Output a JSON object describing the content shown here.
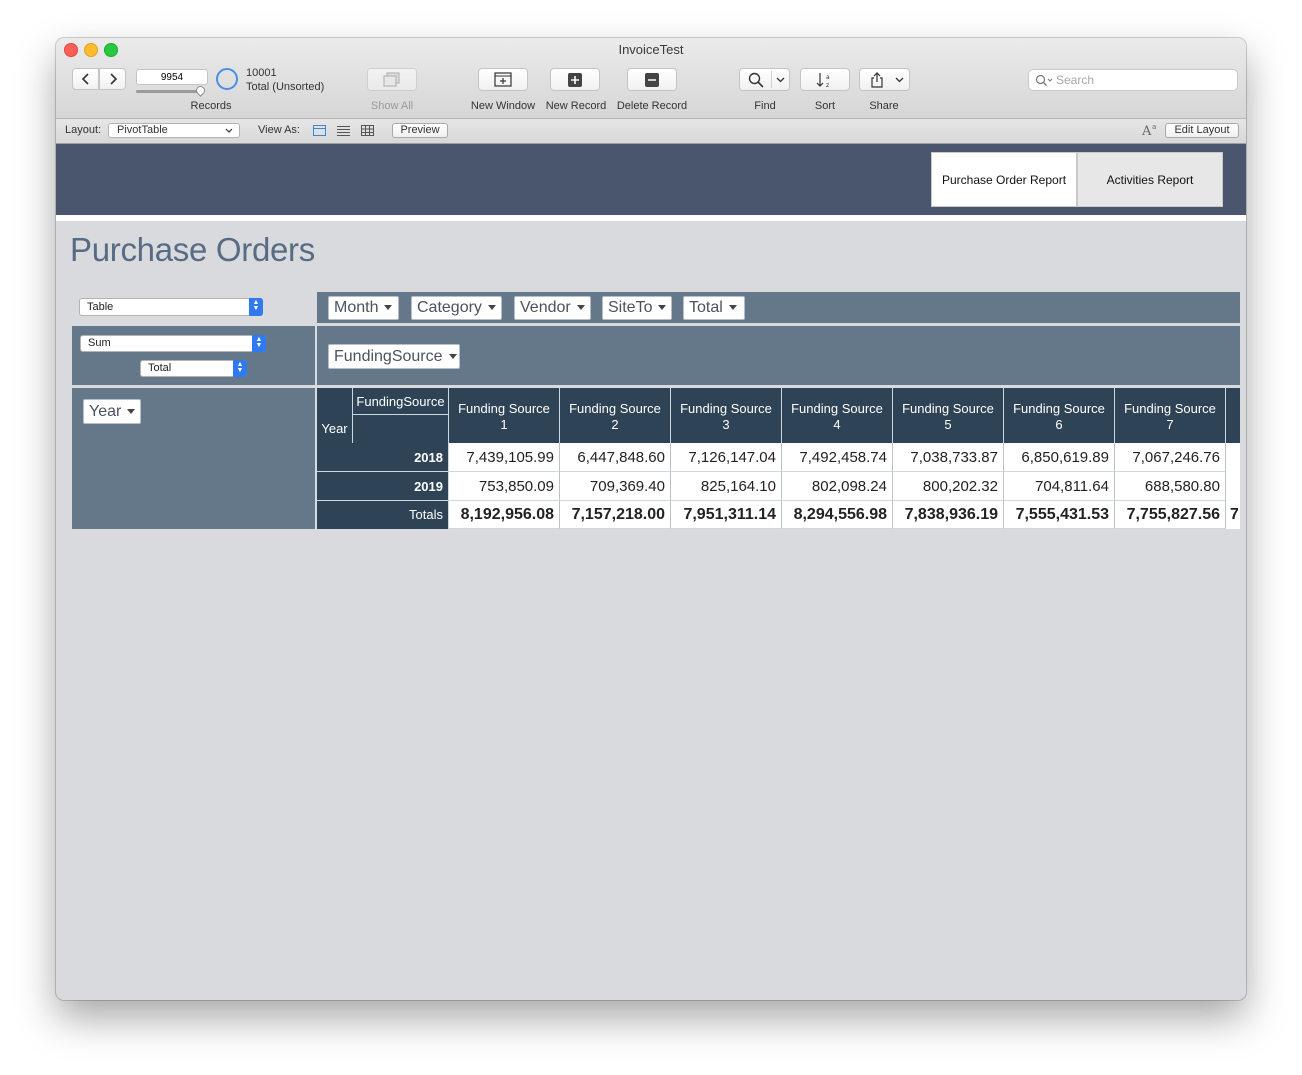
{
  "window": {
    "title": "InvoiceTest"
  },
  "toolbar": {
    "record_number": "9954",
    "records_label": "Records",
    "record_count": "10001",
    "record_status": "Total (Unsorted)",
    "show_all_label": "Show All",
    "new_window_label": "New Window",
    "new_record_label": "New Record",
    "delete_record_label": "Delete Record",
    "find_label": "Find",
    "sort_label": "Sort",
    "share_label": "Share",
    "search_placeholder": "Search"
  },
  "layout_bar": {
    "layout_label": "Layout:",
    "layout_value": "PivotTable",
    "view_as_label": "View As:",
    "preview_label": "Preview",
    "edit_layout_label": "Edit Layout"
  },
  "tabs": [
    {
      "label": "Purchase Order Report",
      "active": true
    },
    {
      "label": "Activities Report",
      "active": false
    }
  ],
  "page": {
    "title": "Purchase Orders"
  },
  "pivot": {
    "view_type": "Table",
    "aggregate": "Sum",
    "aggregate_field": "Total",
    "filter_fields": [
      "Month",
      "Category",
      "Vendor",
      "SiteTo",
      "Total"
    ],
    "column_field": "FundingSource",
    "row_field": "Year",
    "corner_column_label": "FundingSource",
    "corner_row_label": "Year",
    "columns": [
      {
        "line1": "Funding Source",
        "line2": "1"
      },
      {
        "line1": "Funding Source",
        "line2": "2"
      },
      {
        "line1": "Funding Source",
        "line2": "3"
      },
      {
        "line1": "Funding Source",
        "line2": "4"
      },
      {
        "line1": "Funding Source",
        "line2": "5"
      },
      {
        "line1": "Funding Source",
        "line2": "6"
      },
      {
        "line1": "Funding Source",
        "line2": "7"
      }
    ],
    "rows": [
      {
        "label": "2018",
        "values": [
          "7,439,105.99",
          "6,447,848.60",
          "7,126,147.04",
          "7,492,458.74",
          "7,038,733.87",
          "6,850,619.89",
          "7,067,246.76"
        ]
      },
      {
        "label": "2019",
        "values": [
          "753,850.09",
          "709,369.40",
          "825,164.10",
          "802,098.24",
          "800,202.32",
          "704,811.64",
          "688,580.80"
        ]
      }
    ],
    "totals": {
      "label": "Totals",
      "values": [
        "8,192,956.08",
        "7,157,218.00",
        "7,951,311.14",
        "8,294,556.98",
        "7,838,936.19",
        "7,555,431.53",
        "7,755,827.56"
      ]
    }
  }
}
